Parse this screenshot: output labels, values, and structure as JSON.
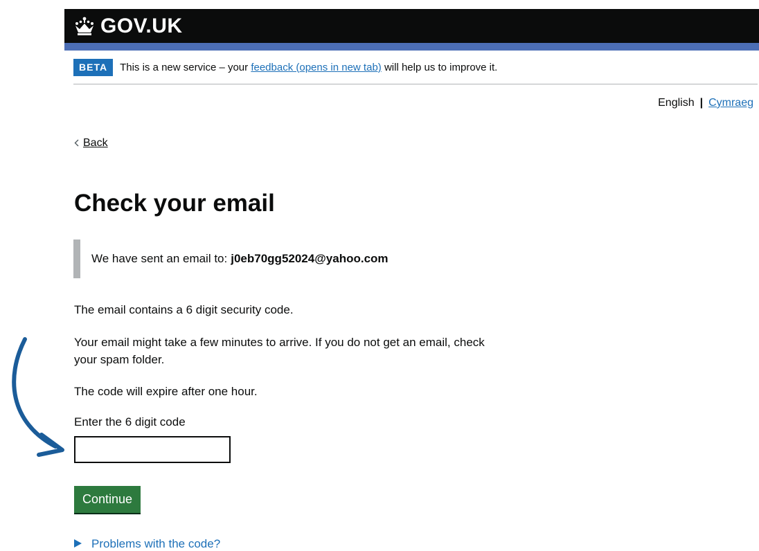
{
  "header": {
    "logo_text": "GOV.UK",
    "crown_icon": "crown-icon",
    "background": "#0b0c0c",
    "accent_bar": "#4c6eb5"
  },
  "phase_banner": {
    "tag": "BETA",
    "text_before": "This is a new service – your ",
    "link_text": "feedback (opens in new tab)",
    "text_after": " will help us to improve it."
  },
  "language": {
    "current": "English",
    "separator": "|",
    "alternate": "Cymraeg"
  },
  "back_link": {
    "label": "Back",
    "icon": "chevron-left-icon"
  },
  "main": {
    "title": "Check your email",
    "inset_prefix": "We have sent an email to:",
    "inset_email": "j0eb70gg52024@yahoo.com",
    "para_1": "The email contains a 6 digit security code.",
    "para_2": "Your email might take a few minutes to arrive. If you do not get an email, check your spam folder.",
    "para_3": "The code will expire after one hour.",
    "input_label": "Enter the 6 digit code",
    "input_value": "",
    "continue_label": "Continue",
    "details_summary": "Problems with the code?"
  },
  "colors": {
    "link": "#1d70b8",
    "button": "#2d7a3e",
    "annotation_arrow": "#1b5c99"
  }
}
